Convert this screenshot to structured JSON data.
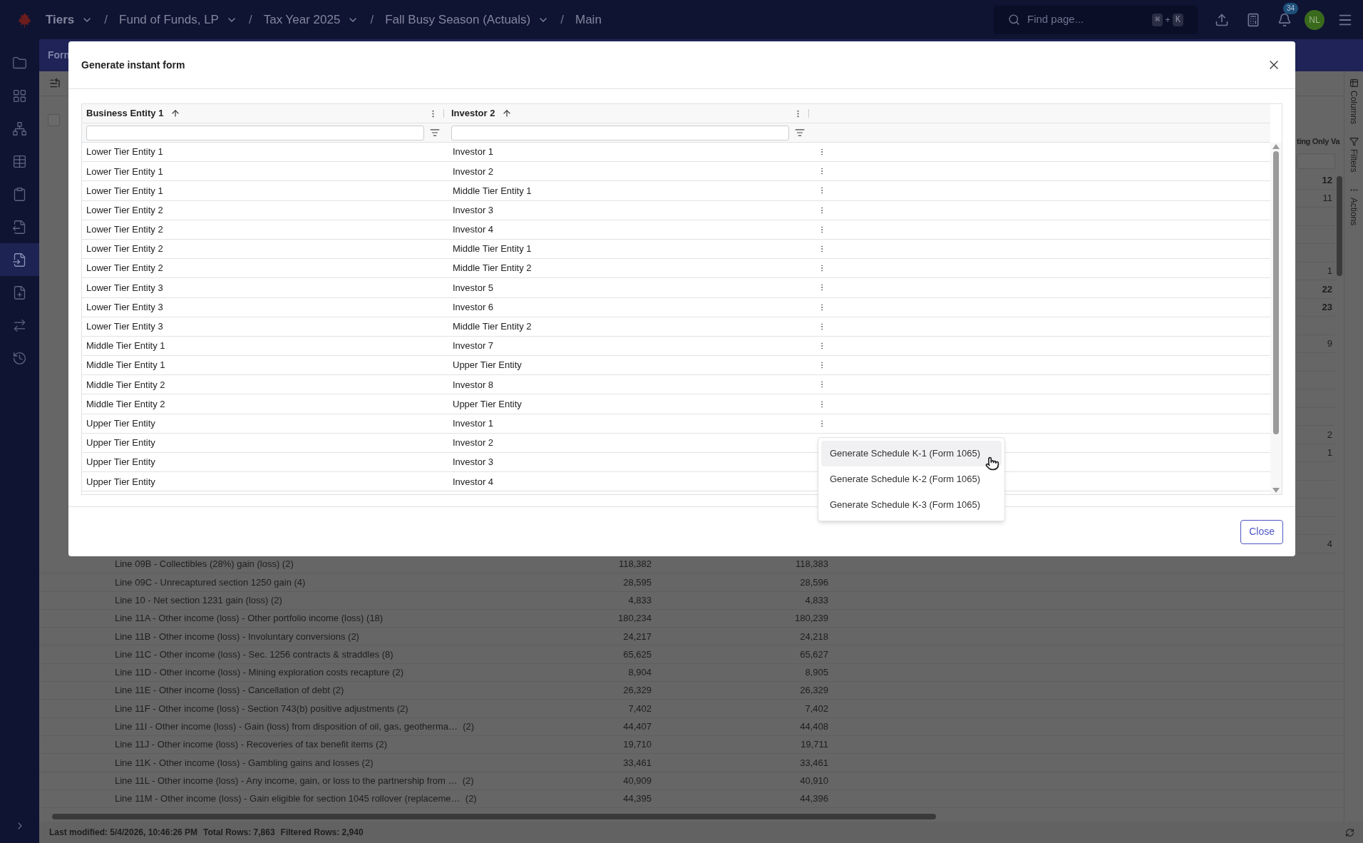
{
  "app_bar": {
    "breadcrumbs": [
      {
        "label": "Tiers",
        "kind": "root",
        "dropdown": true
      },
      {
        "label": "Fund of Funds, LP",
        "kind": "crumb",
        "dropdown": true
      },
      {
        "label": "Tax Year 2025",
        "kind": "crumb",
        "dropdown": true
      },
      {
        "label": "Fall Busy Season (Actuals)",
        "kind": "crumb",
        "dropdown": true
      },
      {
        "label": "Main",
        "kind": "crumb",
        "dropdown": false
      }
    ],
    "separator": "/",
    "search": {
      "placeholder": "Find page...",
      "shortcut": [
        "⌘",
        "+",
        "K"
      ]
    },
    "notifications": {
      "badge": "34"
    },
    "avatar": {
      "initials": "NL"
    }
  },
  "sidebar": {
    "items": [
      {
        "selected": false
      },
      {
        "selected": false
      },
      {
        "selected": false
      },
      {
        "selected": false
      },
      {
        "selected": false
      },
      {
        "selected": false
      },
      {
        "selected": true
      },
      {
        "selected": false
      },
      {
        "selected": false
      },
      {
        "selected": false
      }
    ]
  },
  "background": {
    "tab_label": "Forn",
    "select_all": {
      "checked": false
    },
    "column_header": "ting Only Va",
    "values": [
      {
        "value": "12",
        "bold": true
      },
      {
        "value": "11",
        "bold": false
      },
      {
        "value": "1",
        "bold": false
      },
      {
        "value": "22",
        "bold": true
      },
      {
        "value": "23",
        "bold": true
      },
      {
        "value": "9",
        "bold": false
      },
      {
        "value": "2",
        "bold": false
      },
      {
        "value": "1",
        "bold": false
      },
      {
        "value": "4",
        "bold": false
      }
    ],
    "side_tabs": [
      "Columns",
      "Filters",
      "Actions"
    ],
    "lines": [
      {
        "label": "Line 09B - Collectibles (28%) gain (loss) (2)",
        "value_1": "118,382",
        "value_2": "118,383"
      },
      {
        "label": "Line 09C - Unrecaptured section 1250 gain (4)",
        "value_1": "28,595",
        "value_2": "28,596"
      },
      {
        "label": "Line 10 - Net section 1231 gain (loss) (2)",
        "value_1": "4,833",
        "value_2": "4,833"
      },
      {
        "label": "Line 11A - Other income (loss) - Other portfolio income (loss) (18)",
        "value_1": "180,234",
        "value_2": "180,239"
      },
      {
        "label": "Line 11B - Other income (loss) - Involuntary conversions (2)",
        "value_1": "24,217",
        "value_2": "24,218"
      },
      {
        "label": "Line 11C - Other income (loss) - Sec. 1256 contracts & straddles (8)",
        "value_1": "65,625",
        "value_2": "65,627"
      },
      {
        "label": "Line 11D - Other income (loss) - Mining exploration costs recapture (2)",
        "value_1": "8,904",
        "value_2": "8,905"
      },
      {
        "label": "Line 11E - Other income (loss) - Cancellation of debt (2)",
        "value_1": "26,329",
        "value_2": "26,329"
      },
      {
        "label": "Line 11F - Other income (loss) - Section 743(b) positive adjustments (2)",
        "value_1": "7,402",
        "value_2": "7,402"
      },
      {
        "label": "Line 11I - Other income (loss) - Gain (loss) from disposition of oil, gas, geotherma…  (2)",
        "value_1": "44,407",
        "value_2": "44,408"
      },
      {
        "label": "Line 11J - Other income (loss) - Recoveries of tax benefit items (2)",
        "value_1": "19,710",
        "value_2": "19,711"
      },
      {
        "label": "Line 11K - Other income (loss) - Gambling gains and losses (2)",
        "value_1": "33,461",
        "value_2": "33,461"
      },
      {
        "label": "Line 11L - Other income (loss) - Any income, gain, or loss to the partnership from …  (2)",
        "value_1": "40,909",
        "value_2": "40,910"
      },
      {
        "label": "Line 11M - Other income (loss) - Gain eligible for section 1045 rollover (replaceme…  (2)",
        "value_1": "44,395",
        "value_2": "44,396"
      }
    ],
    "status_bar": {
      "last_modified": "Last modified: 5/4/2026, 10:46:26 PM",
      "total_rows": "Total Rows: 7,863",
      "filtered_rows": "Filtered Rows: 2,940"
    }
  },
  "dialog": {
    "title": "Generate instant form",
    "table": {
      "columns": [
        {
          "label": "Business Entity 1",
          "sorted_ascending": true
        },
        {
          "label": "Investor 2",
          "sorted_ascending": true
        }
      ],
      "rows": [
        {
          "business_entity_1": "Lower Tier Entity 1",
          "investor_2": "Investor 1"
        },
        {
          "business_entity_1": "Lower Tier Entity 1",
          "investor_2": "Investor 2"
        },
        {
          "business_entity_1": "Lower Tier Entity 1",
          "investor_2": "Middle Tier Entity 1"
        },
        {
          "business_entity_1": "Lower Tier Entity 2",
          "investor_2": "Investor 3"
        },
        {
          "business_entity_1": "Lower Tier Entity 2",
          "investor_2": "Investor 4"
        },
        {
          "business_entity_1": "Lower Tier Entity 2",
          "investor_2": "Middle Tier Entity 1"
        },
        {
          "business_entity_1": "Lower Tier Entity 2",
          "investor_2": "Middle Tier Entity 2"
        },
        {
          "business_entity_1": "Lower Tier Entity 3",
          "investor_2": "Investor 5"
        },
        {
          "business_entity_1": "Lower Tier Entity 3",
          "investor_2": "Investor 6"
        },
        {
          "business_entity_1": "Lower Tier Entity 3",
          "investor_2": "Middle Tier Entity 2"
        },
        {
          "business_entity_1": "Middle Tier Entity 1",
          "investor_2": "Investor 7"
        },
        {
          "business_entity_1": "Middle Tier Entity 1",
          "investor_2": "Upper Tier Entity"
        },
        {
          "business_entity_1": "Middle Tier Entity 2",
          "investor_2": "Investor 8"
        },
        {
          "business_entity_1": "Middle Tier Entity 2",
          "investor_2": "Upper Tier Entity"
        },
        {
          "business_entity_1": "Upper Tier Entity",
          "investor_2": "Investor 1"
        },
        {
          "business_entity_1": "Upper Tier Entity",
          "investor_2": "Investor 2"
        },
        {
          "business_entity_1": "Upper Tier Entity",
          "investor_2": "Investor 3"
        },
        {
          "business_entity_1": "Upper Tier Entity",
          "investor_2": "Investor 4"
        }
      ]
    },
    "context_menu": {
      "items": [
        {
          "label": "Generate Schedule K-1 (Form 1065)",
          "highlighted": true
        },
        {
          "label": "Generate Schedule K-2 (Form 1065)",
          "highlighted": false
        },
        {
          "label": "Generate Schedule K-3 (Form 1065)",
          "highlighted": false
        }
      ]
    },
    "close_button": "Close"
  }
}
